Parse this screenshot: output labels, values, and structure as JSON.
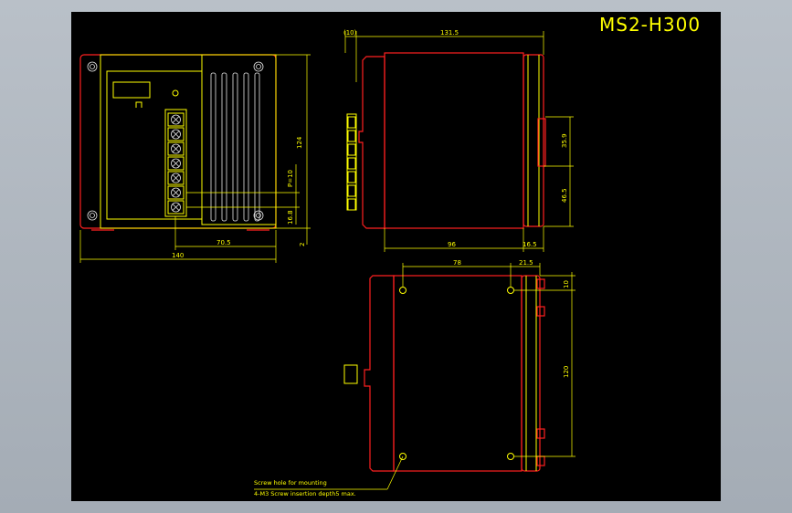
{
  "title": "MS2-H300",
  "front_view": {
    "dim_140": "140",
    "dim_70_5": "70.5",
    "dim_124": "124",
    "dim_p10": "P=10",
    "dim_16_8": "16.8",
    "dim_2": "2"
  },
  "side_view": {
    "dim_10_paren": "(10)",
    "dim_131_5": "131.5",
    "dim_35_9": "35.9",
    "dim_46_5": "46.5",
    "dim_96": "96",
    "dim_16_5": "16.5"
  },
  "top_view": {
    "dim_78": "78",
    "dim_21_5": "21.5",
    "dim_10": "10",
    "dim_120": "120"
  },
  "note": {
    "line1": "Screw hole for mounting",
    "line2": "4-M3 Screw insertion depth5 max."
  }
}
